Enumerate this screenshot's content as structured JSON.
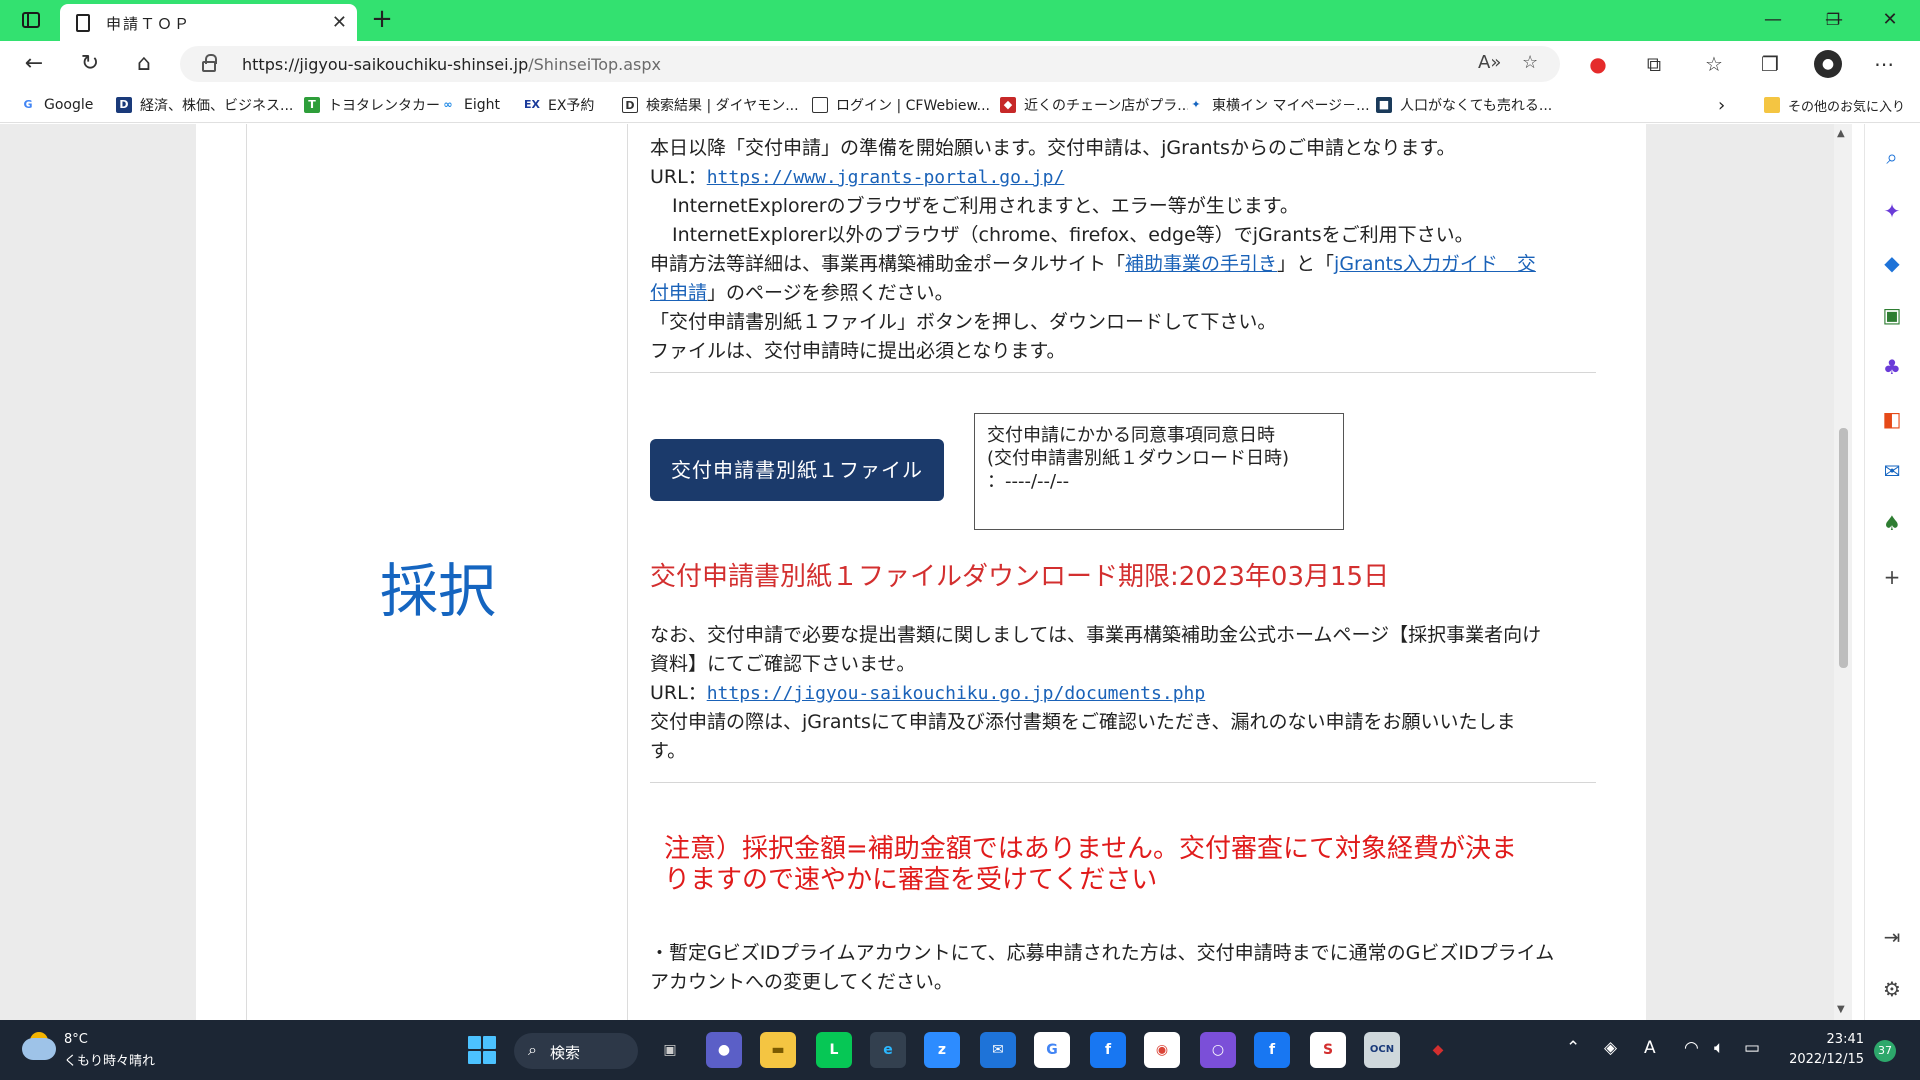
{
  "browser": {
    "tab_title": "申請ＴＯＰ",
    "url_host": "https://jigyou-saikouchiku-shinsei.jp",
    "url_path": "/ShinseiTop.aspx",
    "favorites": [
      {
        "label": "Google",
        "icon": "google-icon"
      },
      {
        "label": "経済、株価、ビジネス...",
        "icon": "diamond-icon"
      },
      {
        "label": "トヨタレンタカー",
        "icon": "toyota-icon"
      },
      {
        "label": "Eight",
        "icon": "eight-icon"
      },
      {
        "label": "EX予約",
        "icon": "ex-icon"
      },
      {
        "label": "検索結果 | ダイヤモン...",
        "icon": "page-icon"
      },
      {
        "label": "ログイン | CFWebiew...",
        "icon": "doc-icon"
      },
      {
        "label": "近くのチェーン店がプラ...",
        "icon": "shield-icon"
      },
      {
        "label": "東横イン マイページ－...",
        "icon": "toyoko-icon"
      },
      {
        "label": "人口がなくても売れる...",
        "icon": "book-icon"
      }
    ],
    "other_favorites": "その他のお気に入り"
  },
  "page": {
    "status_label": "採択",
    "intro_lines": {
      "l1": "本日以降「交付申請」の準備を開始願います。交付申請は、jGrantsからのご申請となります。",
      "url_prefix": "URL：",
      "jgrants_url": "https://www.jgrants-portal.go.jp/",
      "l3": "InternetExplorerのブラウザをご利用されますと、エラー等が生じます。",
      "l4": "InternetExplorer以外のブラウザ（chrome、firefox、edge等）でjGrantsをご利用下さい。",
      "l5_a": "申請方法等詳細は、事業再構築補助金ポータルサイト「",
      "l5_link1": "補助事業の手引き",
      "l5_b": "」と「",
      "l5_link2a": "jGrants入力ガイド　交",
      "l6_link2b": "付申請",
      "l6_b": "」のページを参照ください。",
      "l7": "「交付申請書別紙１ファイル」ボタンを押し、ダウンロードして下さい。",
      "l8": "ファイルは、交付申請時に提出必須となります。"
    },
    "download_button": "交付申請書別紙１ファイル",
    "consent_box": {
      "line1": "交付申請にかかる同意事項同意日時",
      "line2": "(交付申請書別紙１ダウンロード日時)",
      "line3": "：----/--/--"
    },
    "deadline": "交付申請書別紙１ファイルダウンロード期限:2023年03月15日",
    "docs": {
      "l1": "なお、交付申請で必要な提出書類に関しましては、事業再構築補助金公式ホームページ【採択事業者向け",
      "l2": "資料】にてご確認下さいませ。",
      "url_prefix": "URL：",
      "docs_url": "https://jigyou-saikouchiku.go.jp/documents.php",
      "l4": "交付申請の際は、jGrantsにて申請及び添付書類をご確認いただき、漏れのない申請をお願いいたしま",
      "l5": "す。"
    },
    "warning": {
      "l1": "注意）採択金額=補助金額ではありません。交付審査にて対象経費が決ま",
      "l2": "りますので速やかに審査を受けてください"
    },
    "gbiz_note": {
      "l1": "・暫定GビズIDプライムアカウントにて、応募申請された方は、交付申請時までに通常のGビズIDプライム",
      "l2": "アカウントへの変更してください。"
    }
  },
  "taskbar": {
    "weather_temp": "8°C",
    "weather_desc": "くもり時々晴れ",
    "search_label": "検索",
    "time": "23:41",
    "date": "2022/12/15",
    "notification_count": "37"
  },
  "colors": {
    "tab_bar": "#33e170",
    "label_blue": "#1565c0",
    "button_navy": "#1b3a6b",
    "alert_red": "#d32f2f",
    "link_blue": "#1a62b8"
  }
}
